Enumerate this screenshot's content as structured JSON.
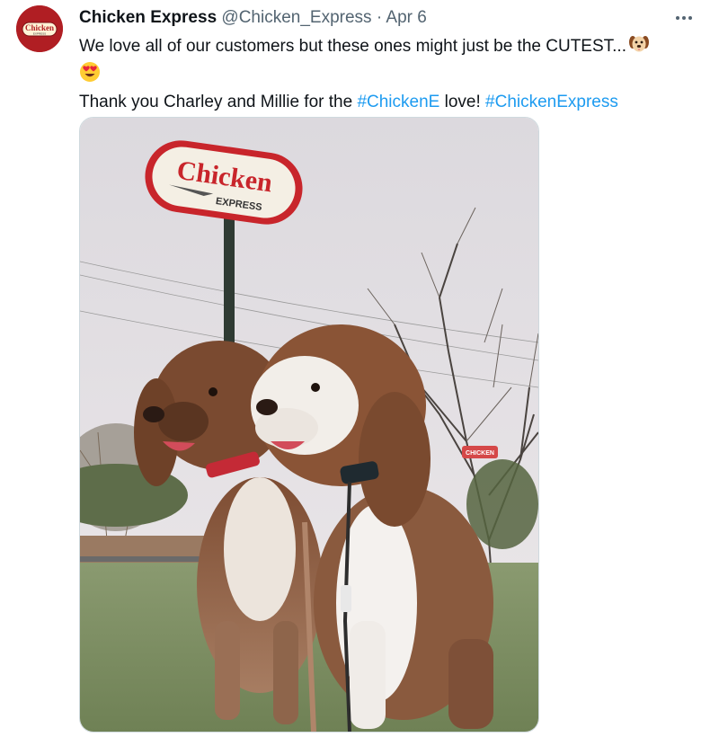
{
  "tweet": {
    "author_name": "Chicken Express",
    "author_handle": "@Chicken_Express",
    "separator": "·",
    "date": "Apr 6",
    "text_line1": "We love all of our customers but these ones might just be the CUTEST...",
    "text_line3_prefix": "Thank you Charley and Millie for the ",
    "hashtag1": "#ChickenE",
    "text_line3_middle": " love! ",
    "hashtag2": "#ChickenExpress",
    "emoji_1": "dog-face-emoji",
    "emoji_2": "heart-eyes-emoji"
  },
  "avatar": {
    "logo_text_top": "Chicken",
    "logo_text_bottom": "EXPRESS",
    "color": "#b01e23"
  },
  "photo": {
    "sign_text_top": "Chicken",
    "sign_text_bottom": "EXPRESS",
    "background_sign_text": "CHICKEN"
  },
  "colors": {
    "hashtag": "#1d9bf0",
    "secondary_text": "#536471",
    "brand_red": "#c8252b"
  }
}
